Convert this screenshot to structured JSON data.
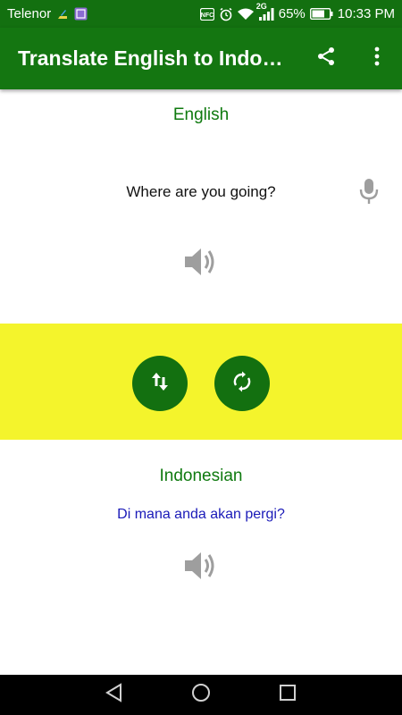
{
  "status_bar": {
    "carrier": "Telenor",
    "network": "2G",
    "battery": "65%",
    "time": "10:33 PM",
    "icons": [
      "sim-toolkit-icon",
      "image-icon",
      "nfc-icon",
      "alarm-icon",
      "wifi-icon",
      "signal-icon",
      "battery-icon"
    ]
  },
  "toolbar": {
    "title": "Translate English to Indonesian",
    "share_icon": "share-icon",
    "menu_icon": "more-vert-icon"
  },
  "source": {
    "language": "English",
    "text": "Where are you going?",
    "mic_icon": "mic-icon",
    "speaker_icon": "speaker-icon"
  },
  "actions": {
    "swap_icon": "swap-vert-icon",
    "refresh_icon": "refresh-icon",
    "band_color": "#f4f42c",
    "button_color": "#137010"
  },
  "target": {
    "language": "Indonesian",
    "text": "Di mana anda akan pergi?",
    "speaker_icon": "speaker-icon"
  },
  "nav": {
    "icons": [
      "back-icon",
      "home-icon",
      "recents-icon"
    ]
  },
  "colors": {
    "primary": "#147611",
    "language_label": "#0f7a0f",
    "translation_text": "#1a1ab8"
  }
}
